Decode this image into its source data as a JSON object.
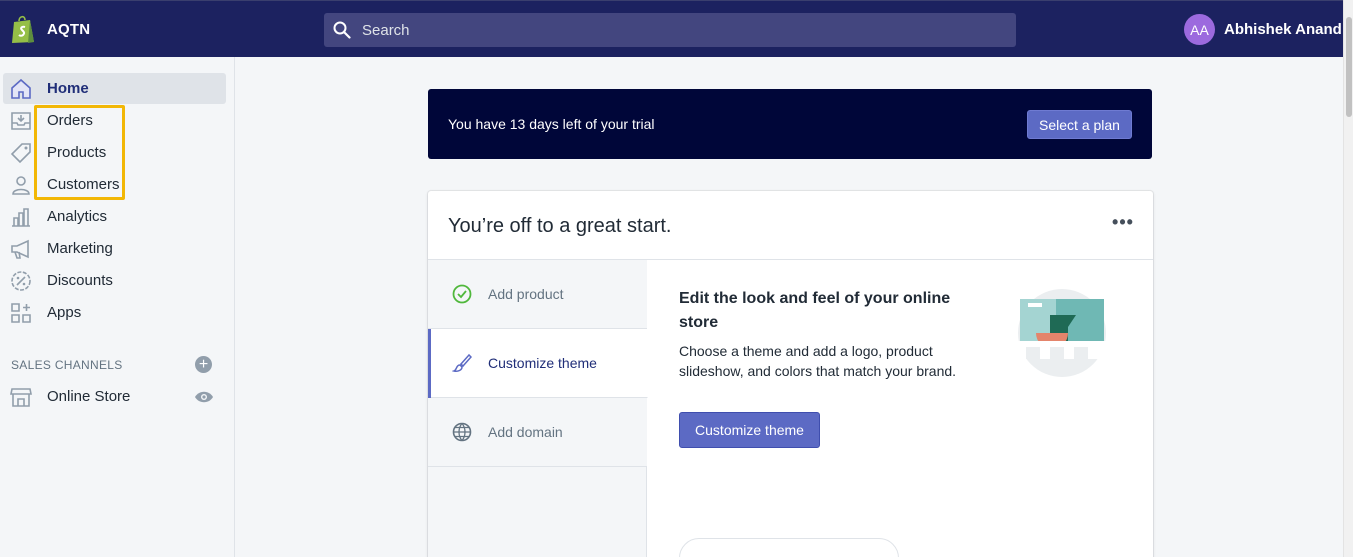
{
  "topbar": {
    "store_name": "AQTN",
    "search_placeholder": "Search",
    "user_initials": "AA",
    "user_name": "Abhishek Anand"
  },
  "sidebar": {
    "items": [
      {
        "label": "Home",
        "icon": "home-icon"
      },
      {
        "label": "Orders",
        "icon": "orders-icon"
      },
      {
        "label": "Products",
        "icon": "tag-icon"
      },
      {
        "label": "Customers",
        "icon": "person-icon"
      },
      {
        "label": "Analytics",
        "icon": "bar-chart-icon"
      },
      {
        "label": "Marketing",
        "icon": "megaphone-icon"
      },
      {
        "label": "Discounts",
        "icon": "discount-icon"
      },
      {
        "label": "Apps",
        "icon": "apps-icon"
      }
    ],
    "section_title": "SALES CHANNELS",
    "add_channel_symbol": "+",
    "channels": [
      {
        "label": "Online Store",
        "icon": "store-icon"
      }
    ]
  },
  "trial_banner": {
    "text": "You have 13 days left of your trial",
    "button": "Select a plan"
  },
  "setup_card": {
    "title": "You’re off to a great start.",
    "more_symbol": "•••",
    "steps": [
      {
        "label": "Add product",
        "icon": "check-circle-icon",
        "state": "done"
      },
      {
        "label": "Customize theme",
        "icon": "brush-icon",
        "state": "active"
      },
      {
        "label": "Add domain",
        "icon": "globe-icon",
        "state": "todo"
      }
    ],
    "detail_heading": "Edit the look and feel of your online store",
    "detail_body": "Choose a theme and add a logo, product slideshow, and colors that match your brand.",
    "detail_button": "Customize theme"
  },
  "colors": {
    "topbar": "#1c2260",
    "search": "#43467f",
    "accent": "#5c6ac4",
    "banner": "#000639",
    "highlight": "#f2b705"
  }
}
